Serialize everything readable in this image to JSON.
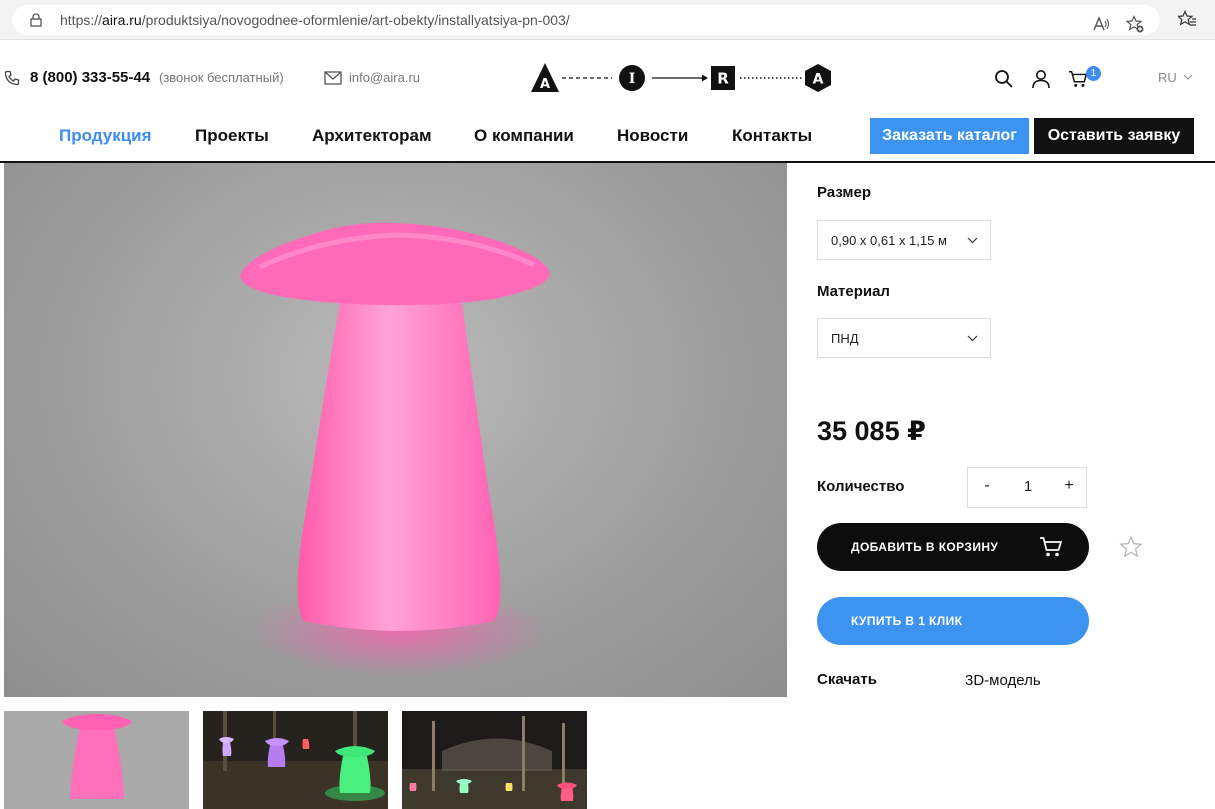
{
  "browser": {
    "url_prefix": "https://",
    "url_host": "aira.ru",
    "url_path": "/produktsiya/novogodnee-oformlenie/art-obekty/installyatsiya-pn-003/"
  },
  "header": {
    "phone": "8 (800) 333-55-44",
    "phone_note": "(звонок бесплатный)",
    "email": "info@aira.ru",
    "logo_letters": [
      "A",
      "I",
      "R",
      "A"
    ],
    "cart_count": "1",
    "language": "RU"
  },
  "nav": {
    "items": [
      {
        "label": "Продукция",
        "active": true
      },
      {
        "label": "Проекты"
      },
      {
        "label": "Архитекторам"
      },
      {
        "label": "О компании"
      },
      {
        "label": "Новости"
      },
      {
        "label": "Контакты"
      }
    ],
    "catalog_button": "Заказать каталог",
    "request_button": "Оставить заявку"
  },
  "product": {
    "size_label": "Размер",
    "size_value": "0,90 х 0,61 х 1,15 м",
    "material_label": "Материал",
    "material_value": "ПНД",
    "price": "35 085 ₽",
    "quantity_label": "Количество",
    "quantity_minus": "-",
    "quantity_value": "1",
    "quantity_plus": "+",
    "add_to_cart": "ДОБАВИТЬ В КОРЗИНУ",
    "buy_one_click": "КУПИТЬ В 1 КЛИК",
    "download_label": "Скачать",
    "download_link": "3D-модель"
  },
  "colors": {
    "accent": "#3d94f0",
    "dark": "#0d0d0d",
    "product_pink": "#ff77c0"
  }
}
